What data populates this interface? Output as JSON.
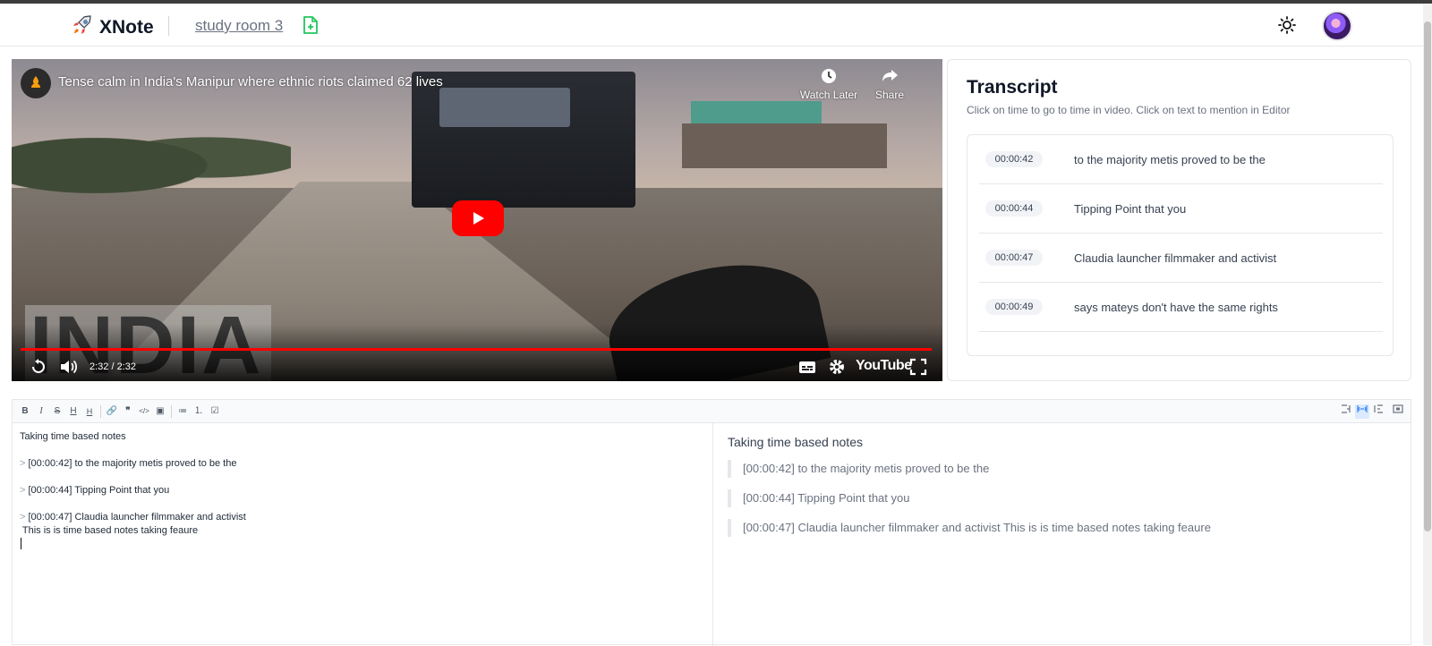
{
  "header": {
    "app_name": "XNote",
    "room_link": "study room 3",
    "icons": [
      "rocket-icon",
      "file-add-icon",
      "sun-icon"
    ]
  },
  "video": {
    "title": "Tense calm in India's Manipur where ethnic riots claimed 62 lives",
    "watch_later_label": "Watch Later",
    "share_label": "Share",
    "overlay_text": "INDIA",
    "time_display": "2:32 / 2:32",
    "youtube_label": "YouTube",
    "progress": 1.0
  },
  "transcript": {
    "title": "Transcript",
    "subtitle": "Click on time to go to time in video. Click on text to mention in Editor",
    "items": [
      {
        "time": "00:00:42",
        "text": "to the majority metis proved to be the"
      },
      {
        "time": "00:00:44",
        "text": "Tipping Point that you"
      },
      {
        "time": "00:00:47",
        "text": "Claudia launcher filmmaker and activist"
      },
      {
        "time": "00:00:49",
        "text": "says mateys don't have the same rights"
      }
    ]
  },
  "editor": {
    "toolbar": {
      "bold": "B",
      "italic": "I",
      "strike": "S",
      "h1": "H",
      "h2": "H",
      "link": "🔗",
      "quote": "❞",
      "code": "</>",
      "image": "▣",
      "ul": "≔",
      "ol": "⒈",
      "task": "☑"
    },
    "source_lines": [
      {
        "marker": "",
        "text": "Taking time based notes"
      },
      {
        "marker": "> ",
        "text": "[00:00:42] to the majority metis proved to be the"
      },
      {
        "marker": "> ",
        "text": "[00:00:44] Tipping Point that you"
      },
      {
        "marker": "> ",
        "text": "[00:00:47] Claudia launcher filmmaker and activist"
      },
      {
        "marker": "",
        "text": " This is is time based notes taking feaure"
      }
    ],
    "preview": {
      "title": "Taking time based notes",
      "quotes": [
        "[00:00:42] to the majority metis proved to be the",
        "[00:00:44] Tipping Point that you",
        "[00:00:47] Claudia launcher filmmaker and activist This is is time based notes taking feaure"
      ]
    }
  },
  "colors": {
    "youtube_red": "#ff0000",
    "time_badge_bg": "#f1f3f6",
    "file_icon_green": "#22c55e"
  }
}
